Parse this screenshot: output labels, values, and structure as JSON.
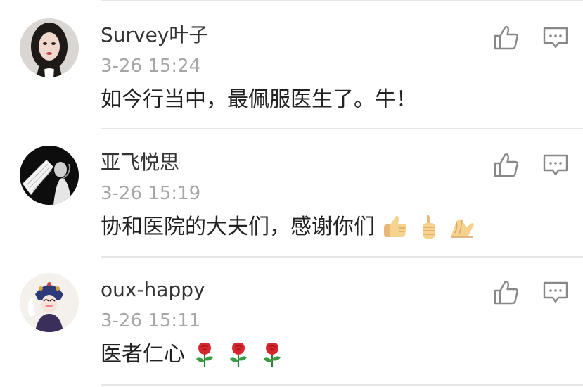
{
  "comments": [
    {
      "username": "Survey叶子",
      "timestamp": "3-26 15:24",
      "text": "如今行当中，最佩服医生了。牛！",
      "emojis": []
    },
    {
      "username": "亚飞悦思",
      "timestamp": "3-26 15:19",
      "text": "协和医院的大夫们，感谢你们",
      "emojis": [
        "thumbs-up",
        "thumbs-up",
        "pinched-fingers"
      ]
    },
    {
      "username": "oux-happy",
      "timestamp": "3-26 15:11",
      "text": "医者仁心",
      "emojis": [
        "rose",
        "rose",
        "rose"
      ]
    }
  ],
  "icons": {
    "like": "thumbs-up-outline-icon",
    "reply": "comment-bubble-icon"
  },
  "colors": {
    "username": "#333333",
    "timestamp": "#a6a6a6",
    "content": "#222222",
    "icon": "#888888",
    "divider": "#e6e6e6"
  }
}
